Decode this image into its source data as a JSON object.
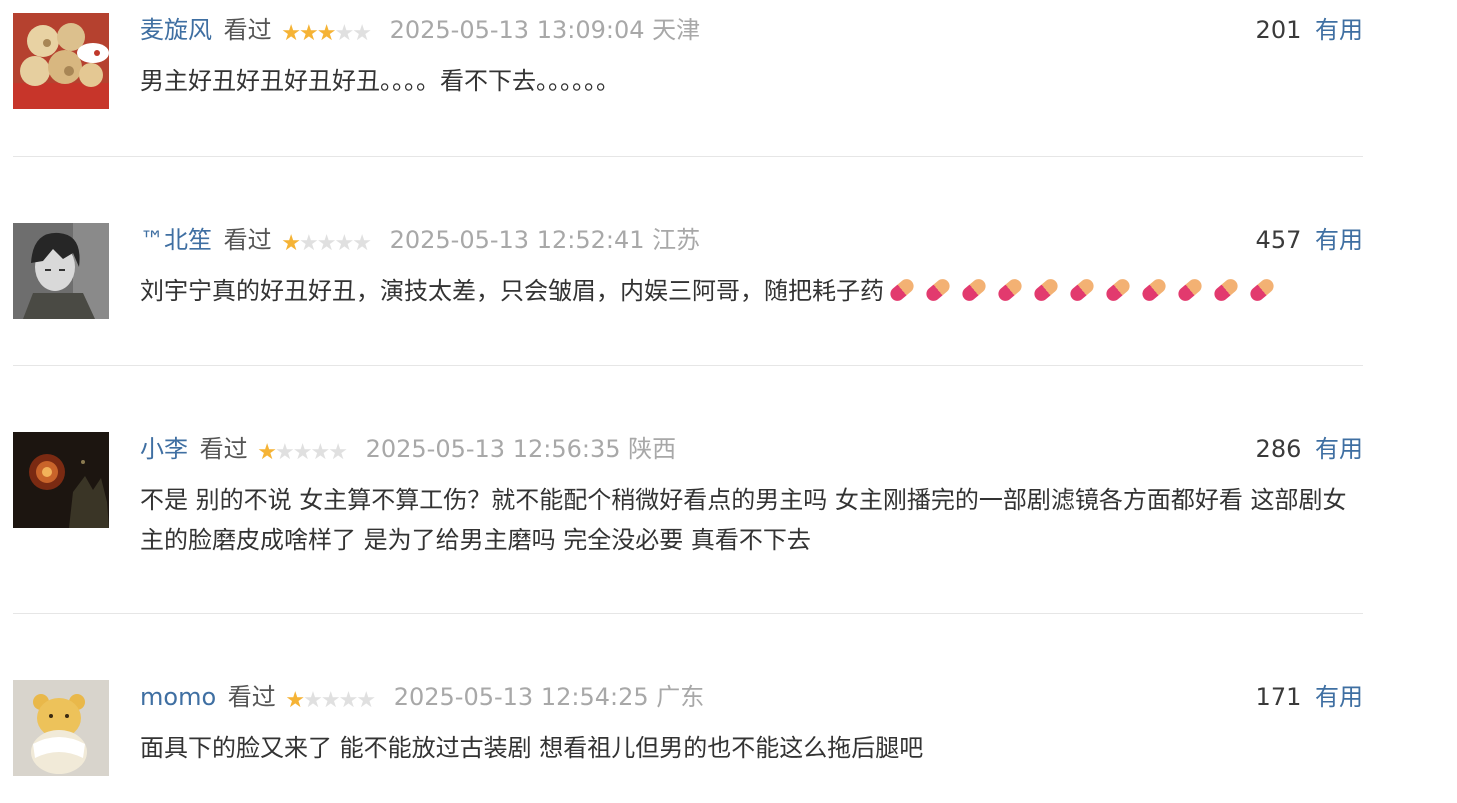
{
  "comments": [
    {
      "user": "麦旋风",
      "status": "看过",
      "rating": 3,
      "max_rating": 5,
      "time": "2025-05-13 13:09:04",
      "location": "天津",
      "votes": "201",
      "useful_label": "有用",
      "text": "男主好丑好丑好丑好丑。。。。看不下去。。。。。。",
      "pill_count": 0,
      "avatar_icon": "food-photo-avatar"
    },
    {
      "user": "™北笙",
      "status": "看过",
      "rating": 1,
      "max_rating": 5,
      "time": "2025-05-13 12:52:41",
      "location": "江苏",
      "votes": "457",
      "useful_label": "有用",
      "text": "刘宇宁真的好丑好丑，演技太差，只会皱眉，内娱三阿哥，随把耗子药",
      "pill_count": 11,
      "pill_icon": "pill-emoji-icon",
      "avatar_icon": "anime-boy-avatar"
    },
    {
      "user": "小李",
      "status": "看过",
      "rating": 1,
      "max_rating": 5,
      "time": "2025-05-13 12:56:35",
      "location": "陕西",
      "votes": "286",
      "useful_label": "有用",
      "text": "不是 别的不说 女主算不算工伤？就不能配个稍微好看点的男主吗 女主刚播完的一部剧滤镜各方面都好看 这部剧女主的脸磨皮成啥样了 是为了给男主磨吗 完全没必要 真看不下去",
      "pill_count": 0,
      "avatar_icon": "lantern-night-avatar"
    },
    {
      "user": "momo",
      "status": "看过",
      "rating": 1,
      "max_rating": 5,
      "time": "2025-05-13 12:54:25",
      "location": "广东",
      "votes": "171",
      "useful_label": "有用",
      "text": "面具下的脸又来了 能不能放过古装剧 想看祖儿但男的也不能这么拖后腿吧",
      "pill_count": 0,
      "avatar_icon": "bear-figurine-avatar"
    }
  ],
  "colors": {
    "link": "#3f6fa2",
    "star_on": "#f5b335",
    "star_off": "#e0e0e0",
    "muted": "#a8a8a8"
  }
}
